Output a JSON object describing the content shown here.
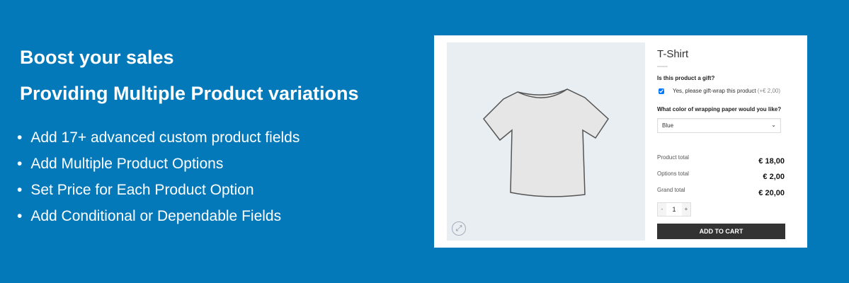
{
  "headline": [
    "Boost your sales",
    "Providing Multiple Product variations"
  ],
  "features": [
    "Add 17+ advanced custom product fields",
    "Add Multiple Product Options",
    "Set Price for Each Product Option",
    "Add Conditional or Dependable Fields"
  ],
  "product": {
    "title": "T-Shirt",
    "gift_question": "Is this product a gift?",
    "gift_checkbox_label": "Yes, please gift-wrap this product",
    "gift_price": "(+€ 2,00)",
    "gift_checked": true,
    "color_question": "What color of wrapping paper would you like?",
    "color_selected": "Blue",
    "totals": [
      {
        "label": "Product total",
        "value": "€ 18,00"
      },
      {
        "label": "Options total",
        "value": "€ 2,00"
      },
      {
        "label": "Grand total",
        "value": "€ 20,00"
      }
    ],
    "quantity": "1",
    "minus": "-",
    "plus": "+",
    "add_to_cart": "ADD TO CART"
  },
  "colors": {
    "background": "#0479ba",
    "button": "#333333"
  }
}
